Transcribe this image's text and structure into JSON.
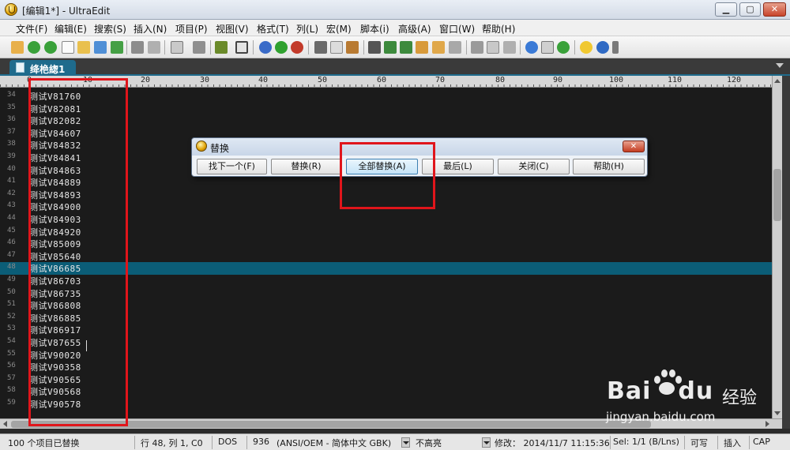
{
  "window": {
    "title": "[编辑1*] - UltraEdit",
    "minimize": "▁",
    "maximize": "▢",
    "close": "✕"
  },
  "menu": [
    "文件(F)",
    "编辑(E)",
    "搜索(S)",
    "插入(N)",
    "项目(P)",
    "视图(V)",
    "格式(T)",
    "列(L)",
    "宏(M)",
    "脚本(i)",
    "高级(A)",
    "窗口(W)",
    "帮助(H)"
  ],
  "tab": {
    "label": "绛栬緫1"
  },
  "ruler": {
    "labels": [
      "0",
      "10",
      "20",
      "30",
      "40",
      "50",
      "60",
      "70",
      "80",
      "90",
      "100",
      "110",
      "120"
    ]
  },
  "editor": {
    "active_line": 48,
    "lines": [
      {
        "num": "34",
        "text": "测试V81760"
      },
      {
        "num": "35",
        "text": "测试V82081"
      },
      {
        "num": "36",
        "text": "测试V82082"
      },
      {
        "num": "37",
        "text": "测试V84607"
      },
      {
        "num": "38",
        "text": "测试V84832"
      },
      {
        "num": "39",
        "text": "测试V84841"
      },
      {
        "num": "40",
        "text": "测试V84863"
      },
      {
        "num": "41",
        "text": "测试V84889"
      },
      {
        "num": "42",
        "text": "测试V84893"
      },
      {
        "num": "43",
        "text": "测试V84900"
      },
      {
        "num": "44",
        "text": "测试V84903"
      },
      {
        "num": "45",
        "text": "测试V84920"
      },
      {
        "num": "46",
        "text": "测试V85009"
      },
      {
        "num": "47",
        "text": "测试V85640"
      },
      {
        "num": "48",
        "text": "测试V86685"
      },
      {
        "num": "49",
        "text": "测试V86703"
      },
      {
        "num": "50",
        "text": "测试V86735"
      },
      {
        "num": "51",
        "text": "测试V86808"
      },
      {
        "num": "52",
        "text": "测试V86885"
      },
      {
        "num": "53",
        "text": "测试V86917"
      },
      {
        "num": "54",
        "text": "测试V87655"
      },
      {
        "num": "55",
        "text": "测试V90020"
      },
      {
        "num": "56",
        "text": "测试V90358"
      },
      {
        "num": "57",
        "text": "测试V90565"
      },
      {
        "num": "58",
        "text": "测试V90568"
      },
      {
        "num": "59",
        "text": "测试V90578"
      }
    ]
  },
  "dialog": {
    "title": "替换",
    "close": "✕",
    "buttons": {
      "find_next": "找下一个(F)",
      "replace": "替换(R)",
      "replace_all": "全部替换(A)",
      "last": "最后(L)",
      "close": "关闭(C)",
      "help": "帮助(H)"
    }
  },
  "status": {
    "message": "100 个项目已替换",
    "position": "行 48, 列 1, C0",
    "line_ending": "DOS",
    "codepage": "936",
    "encoding": "(ANSI/OEM - 简体中文 GBK)",
    "highlight": "不高亮",
    "modified": "修改： 2014/11/7 11:15:36",
    "selection": "Sel: 1/1 (B/Lns)",
    "writable": "可写",
    "insert_mode": "插入",
    "caps": "CAP"
  },
  "watermark": {
    "brand": "Bai",
    "brand2": "du",
    "jingyan": "经验",
    "url": "jingyan.baidu.com"
  },
  "colors": {
    "editor_bg": "#1b1b1b",
    "active_line": "#0b5d77",
    "annotation": "#e0151b"
  }
}
